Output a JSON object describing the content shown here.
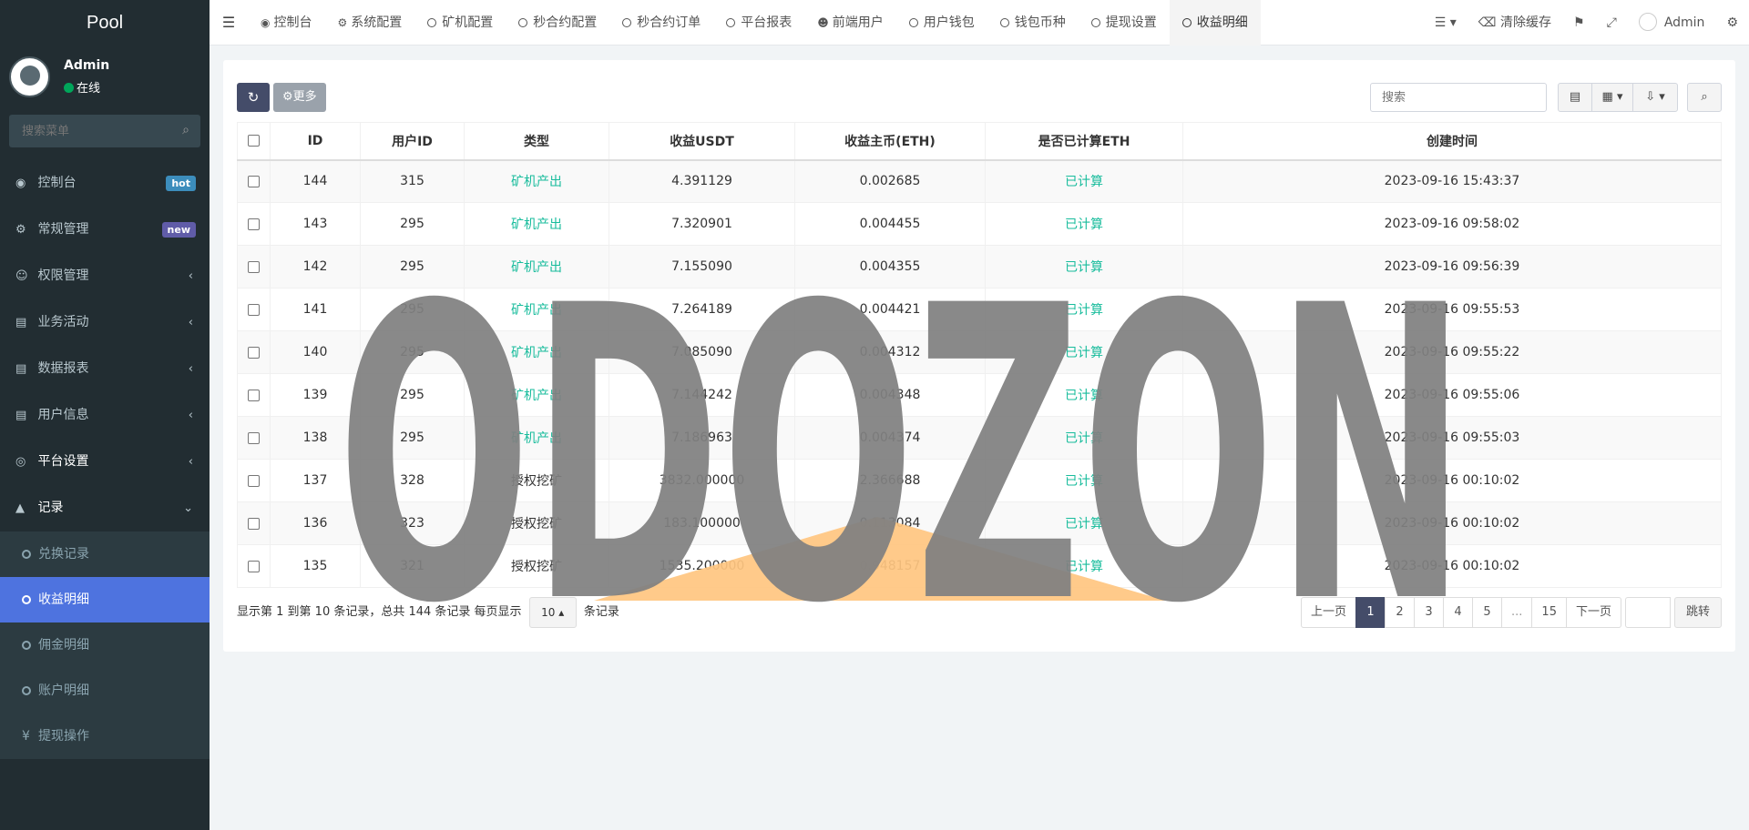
{
  "brand": "Pool",
  "user": {
    "name": "Admin",
    "status": "在线"
  },
  "sidebar_search_placeholder": "搜索菜单",
  "menu": [
    {
      "label": "控制台",
      "icon": "dashboard-icon",
      "badge": "hot"
    },
    {
      "label": "常规管理",
      "icon": "cogs-icon",
      "badge": "new"
    },
    {
      "label": "权限管理",
      "icon": "users-icon"
    },
    {
      "label": "业务活动",
      "icon": "id-card-icon"
    },
    {
      "label": "数据报表",
      "icon": "file-icon"
    },
    {
      "label": "用户信息",
      "icon": "address-book-icon"
    },
    {
      "label": "平台设置",
      "icon": "bullseye-icon"
    },
    {
      "label": "记录",
      "icon": "area-chart-icon"
    }
  ],
  "submenu": [
    {
      "label": "兑换记录"
    },
    {
      "label": "收益明细"
    },
    {
      "label": "佣金明细"
    },
    {
      "label": "账户明细"
    },
    {
      "label": "提现操作"
    }
  ],
  "tabs": [
    {
      "label": "控制台",
      "icon": "dashboard-icon"
    },
    {
      "label": "系统配置",
      "icon": "gear-icon"
    },
    {
      "label": "矿机配置",
      "icon": "circle-icon"
    },
    {
      "label": "秒合约配置",
      "icon": "circle-icon"
    },
    {
      "label": "秒合约订单",
      "icon": "circle-icon"
    },
    {
      "label": "平台报表",
      "icon": "circle-icon"
    },
    {
      "label": "前端用户",
      "icon": "user-circle-icon"
    },
    {
      "label": "用户钱包",
      "icon": "circle-icon"
    },
    {
      "label": "钱包币种",
      "icon": "circle-icon"
    },
    {
      "label": "提现设置",
      "icon": "circle-icon"
    },
    {
      "label": "收益明细",
      "icon": "circle-icon"
    }
  ],
  "top_right": {
    "clear_cache": "清除缓存",
    "user": "Admin"
  },
  "toolbar": {
    "more": "更多",
    "search_placeholder": "搜索"
  },
  "table": {
    "headers": [
      "ID",
      "用户ID",
      "类型",
      "收益USDT",
      "收益主币(ETH)",
      "是否已计算ETH",
      "创建时间"
    ],
    "rows": [
      [
        "144",
        "315",
        "矿机产出",
        "4.391129",
        "0.002685",
        "已计算",
        "2023-09-16 15:43:37"
      ],
      [
        "143",
        "295",
        "矿机产出",
        "7.320901",
        "0.004455",
        "已计算",
        "2023-09-16 09:58:02"
      ],
      [
        "142",
        "295",
        "矿机产出",
        "7.155090",
        "0.004355",
        "已计算",
        "2023-09-16 09:56:39"
      ],
      [
        "141",
        "295",
        "矿机产出",
        "7.264189",
        "0.004421",
        "已计算",
        "2023-09-16 09:55:53"
      ],
      [
        "140",
        "295",
        "矿机产出",
        "7.085090",
        "0.004312",
        "已计算",
        "2023-09-16 09:55:22"
      ],
      [
        "139",
        "295",
        "矿机产出",
        "7.144242",
        "0.004348",
        "已计算",
        "2023-09-16 09:55:06"
      ],
      [
        "138",
        "295",
        "矿机产出",
        "7.186963",
        "0.004374",
        "已计算",
        "2023-09-16 09:55:03"
      ],
      [
        "137",
        "328",
        "授权挖矿",
        "3832.000000",
        "2.366688",
        "已计算",
        "2023-09-16 00:10:02"
      ],
      [
        "136",
        "323",
        "授权挖矿",
        "183.100000",
        "0.113084",
        "已计算",
        "2023-09-16 00:10:02"
      ],
      [
        "135",
        "321",
        "授权挖矿",
        "1535.200000",
        "0.948157",
        "已计算",
        "2023-09-16 00:10:02"
      ]
    ]
  },
  "pagination": {
    "info_prefix": "显示第 1 到第 10 条记录，总共 144 条记录 每页显示",
    "page_size": "10",
    "info_suffix": "条记录",
    "prev": "上一页",
    "pages": [
      "1",
      "2",
      "3",
      "4",
      "5",
      "...",
      "15"
    ],
    "next": "下一页",
    "jump": "跳转"
  },
  "watermark_text": "ODOZON",
  "colors": {
    "sidebar": "#222d32",
    "active": "#4e73df",
    "accent_green": "#18bc9c",
    "primary_btn": "#444c69",
    "watermark": "#808080",
    "watermark_triangle": "#ffc680"
  }
}
